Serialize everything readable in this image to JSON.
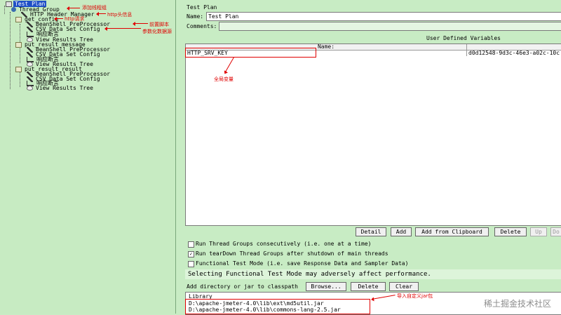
{
  "tree": {
    "items": [
      {
        "label": "Test Plan",
        "icon": "plan",
        "selected": true
      },
      {
        "label": "Thread Group",
        "icon": "gear"
      },
      {
        "label": "HTTP Header Manager",
        "icon": "tool"
      },
      {
        "label": "get_config",
        "icon": "fold"
      },
      {
        "label": "BeanShell PreProcessor",
        "icon": "tool"
      },
      {
        "label": "CSV Data Set Config",
        "icon": "tool"
      },
      {
        "label": "响应断言",
        "icon": "scale"
      },
      {
        "label": "View Results Tree",
        "icon": "eye"
      },
      {
        "label": "put_result_message",
        "icon": "fold"
      },
      {
        "label": "BeanShell PreProcessor",
        "icon": "tool"
      },
      {
        "label": "CSV Data Set Config",
        "icon": "tool"
      },
      {
        "label": "响应断言",
        "icon": "scale"
      },
      {
        "label": "View Results Tree",
        "icon": "eye"
      },
      {
        "label": "put_result_result",
        "icon": "fold"
      },
      {
        "label": "BeanShell PreProcessor",
        "icon": "tool"
      },
      {
        "label": "CSV Data Set Config",
        "icon": "tool"
      },
      {
        "label": "响应断言",
        "icon": "scale"
      },
      {
        "label": "View Results Tree",
        "icon": "eye"
      }
    ],
    "annotations": {
      "add_thread_group": "添加线程组",
      "http_header": "http头信息",
      "http_request": "http请求",
      "preprocess_script": "前置脚本",
      "param_data_source": "参数化数据源"
    }
  },
  "panel": {
    "heading": "Test Plan",
    "name_label": "Name:",
    "name_value": "Test Plan",
    "comments_label": "Comments:",
    "udv_title": "User Defined Variables",
    "columns": {
      "name": "Name:",
      "value": ""
    },
    "variables": [
      {
        "name": "HTTP_SRV_KEY",
        "value": "d0d12548-9d3c-46e3-a02c-10c"
      }
    ],
    "global_var_annotation": "全局变量",
    "buttons": {
      "detail": "Detail",
      "add": "Add",
      "add_clipboard": "Add from Clipboard",
      "delete": "Delete",
      "up": "Up",
      "down": "Do"
    },
    "options": [
      {
        "label": "Run Thread Groups consecutively (i.e. one at a time)",
        "checked": false
      },
      {
        "label": "Run tearDown Thread Groups after shutdown of main threads",
        "checked": true
      },
      {
        "label": "Functional Test Mode (i.e. save Response Data and Sampler Data)",
        "checked": false
      }
    ],
    "warning": "Selecting Functional Test Mode may adversely affect performance.",
    "classpath_label": "Add directory or jar to classpath",
    "classpath_buttons": {
      "browse": "Browse...",
      "delete": "Delete",
      "clear": "Clear"
    },
    "library_header": "Library",
    "library_items": [
      "D:\\apache-jmeter-4.0\\lib\\ext\\md5util.jar",
      "D:\\apache-jmeter-4.0\\lib\\commons-lang-2.5.jar"
    ],
    "jar_annotation": "导入自定义jar包"
  },
  "watermark": "稀土掘金技术社区",
  "colors": {
    "tree_bg": "#c7ebc2",
    "panel_bg": "#c8ecc4",
    "selection": "#1f4fc6",
    "annotation": "#e00000"
  }
}
